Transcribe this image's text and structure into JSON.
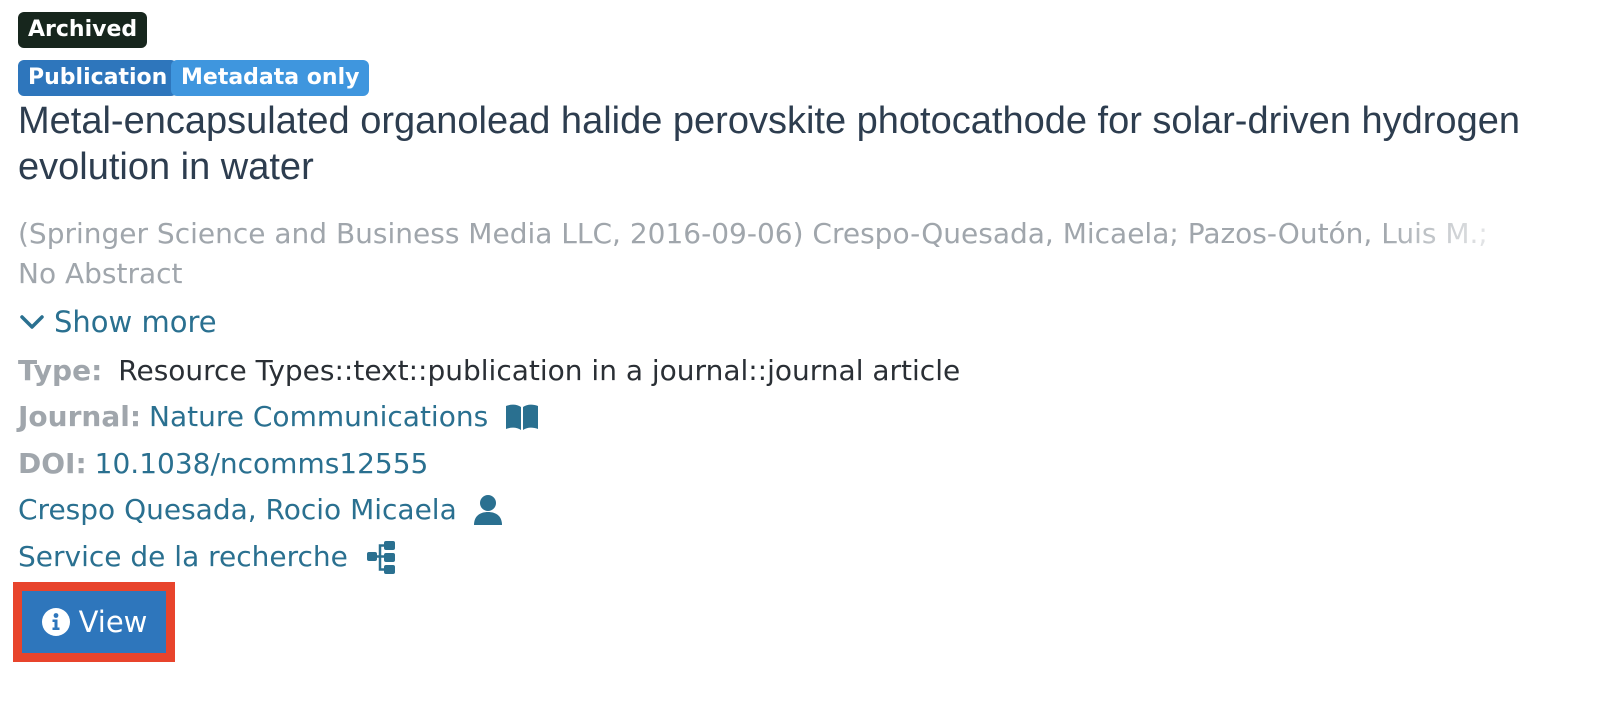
{
  "badges": {
    "archived": "Archived",
    "publication": "Publication",
    "metadata_only": "Metadata only"
  },
  "record": {
    "title": "Metal-encapsulated organolead halide perovskite photocathode for solar-driven hydrogen evolution in water",
    "meta_line": "(Springer Science and Business Media LLC, 2016-09-06) Crespo-Quesada, Micaela; Pazos-Outón, Luis M.;",
    "abstract": "No Abstract",
    "show_more": "Show more"
  },
  "fields": {
    "type_label": "Type:",
    "type_value": "Resource Types::text::publication in a journal::journal article",
    "journal_label": "Journal:",
    "journal_value": "Nature Communications",
    "doi_label": "DOI:",
    "doi_value": "10.1038/ncomms12555",
    "person": "Crespo Quesada, Rocio Micaela",
    "organization": "Service de la recherche"
  },
  "actions": {
    "view_label": "View"
  },
  "icons": {
    "show_more": "chevron-down-icon",
    "journal": "book-open-icon",
    "person": "user-icon",
    "organization": "sitemap-icon",
    "view": "info-circle-icon"
  },
  "colors": {
    "archived_badge": "#17261d",
    "publication_badge": "#2e76bc",
    "metadata_badge": "#3f96de",
    "link": "#2a7090",
    "muted": "#a0a6ac",
    "button": "#2e76bc",
    "highlight": "#e8442c"
  }
}
